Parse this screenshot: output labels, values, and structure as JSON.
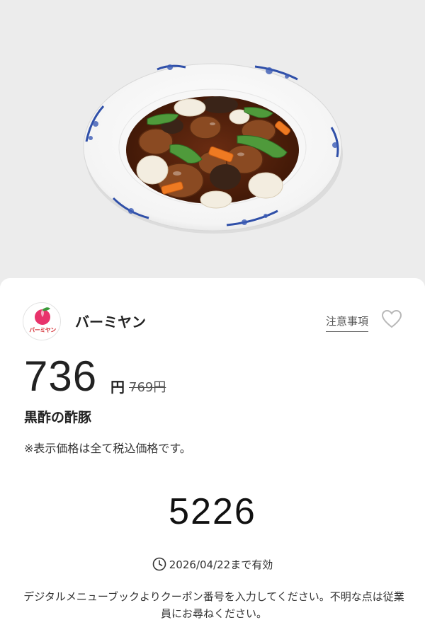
{
  "brand": {
    "name": "バーミヤン",
    "logo_text": "バーミヤン"
  },
  "links": {
    "notice_label": "注意事項"
  },
  "offer": {
    "price": "736",
    "price_unit": "円",
    "original_price": "769円",
    "item_name": "黒酢の酢豚",
    "tax_note": "※表示価格は全て税込価格です。"
  },
  "coupon": {
    "code": "5226",
    "valid_until": "2026/04/22まで有効",
    "instructions": "デジタルメニューブックよりクーポン番号を入力してください。不明な点は従業員にお尋ねください。"
  },
  "icons": {
    "heart": "heart-outline-icon",
    "clock": "clock-icon",
    "logo": "peach-logo-icon"
  },
  "colors": {
    "brand_red": "#d2232a",
    "logo_pink": "#e8336b"
  }
}
